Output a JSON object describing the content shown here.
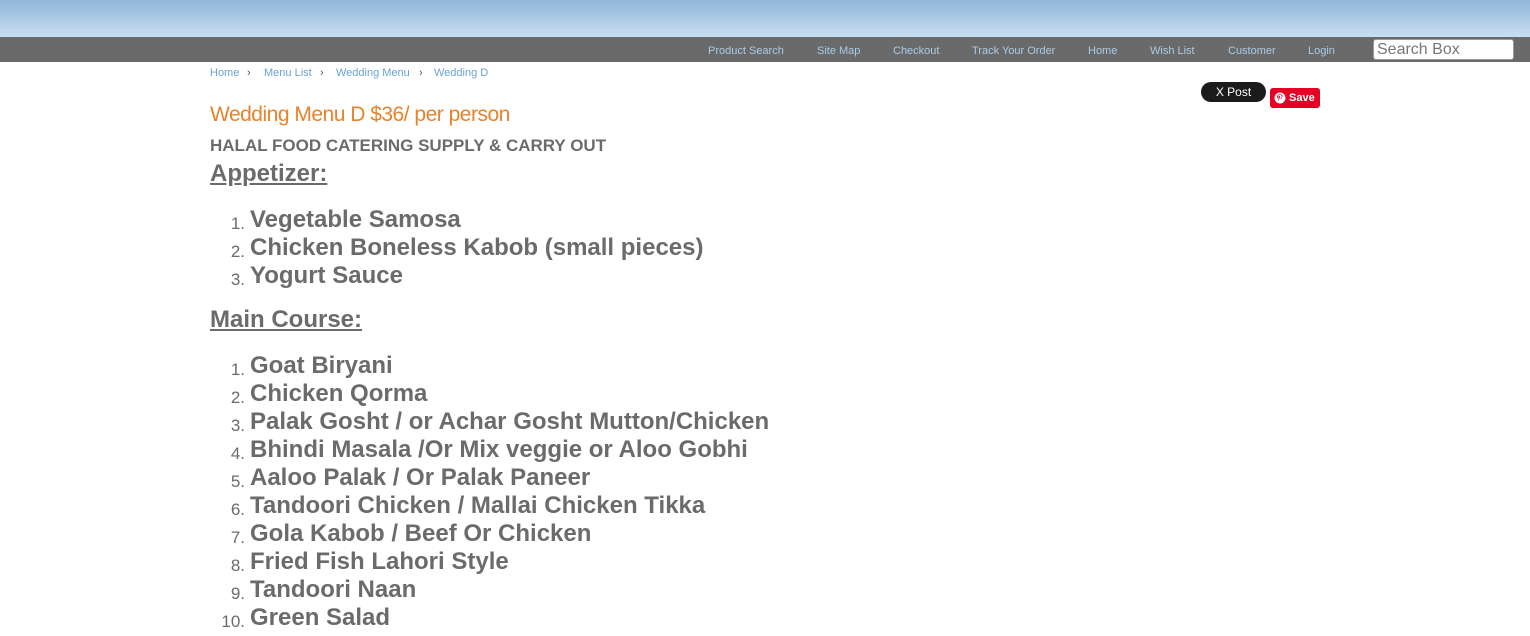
{
  "nav": {
    "links": [
      "Product Search",
      "Site Map",
      "Checkout",
      "Track Your Order",
      "Home",
      "Wish List",
      "Customer",
      "Login"
    ]
  },
  "search": {
    "placeholder": "Search Box"
  },
  "breadcrumb": [
    "Home",
    "Menu List",
    "Wedding Menu",
    "Wedding D"
  ],
  "social": {
    "tweet_label": "X Post",
    "save_label": "Save"
  },
  "page": {
    "title": "Wedding Menu D $36/ per person",
    "subtitle": "HALAL FOOD CATERING SUPPLY & CARRY OUT"
  },
  "sections": [
    {
      "heading": "Appetizer:",
      "items": [
        "Vegetable Samosa",
        "Chicken Boneless Kabob (small pieces)",
        "Yogurt Sauce"
      ]
    },
    {
      "heading": "Main Course:",
      "items": [
        "Goat Biryani",
        "Chicken Qorma",
        "Palak Gosht / or Achar Gosht Mutton/Chicken",
        "Bhindi Masala /Or Mix veggie or Aloo Gobhi",
        "Aaloo Palak / Or Palak Paneer",
        "Tandoori Chicken / Mallai Chicken Tikka",
        "Gola Kabob / Beef Or Chicken",
        "Fried Fish Lahori Style",
        "Tandoori Naan",
        "Green Salad"
      ]
    }
  ],
  "colors": {
    "title_orange": "#e8832a",
    "nav_bar": "#6a6a6a",
    "link_blue": "#6aa2d4",
    "pinterest_red": "#e60023"
  }
}
